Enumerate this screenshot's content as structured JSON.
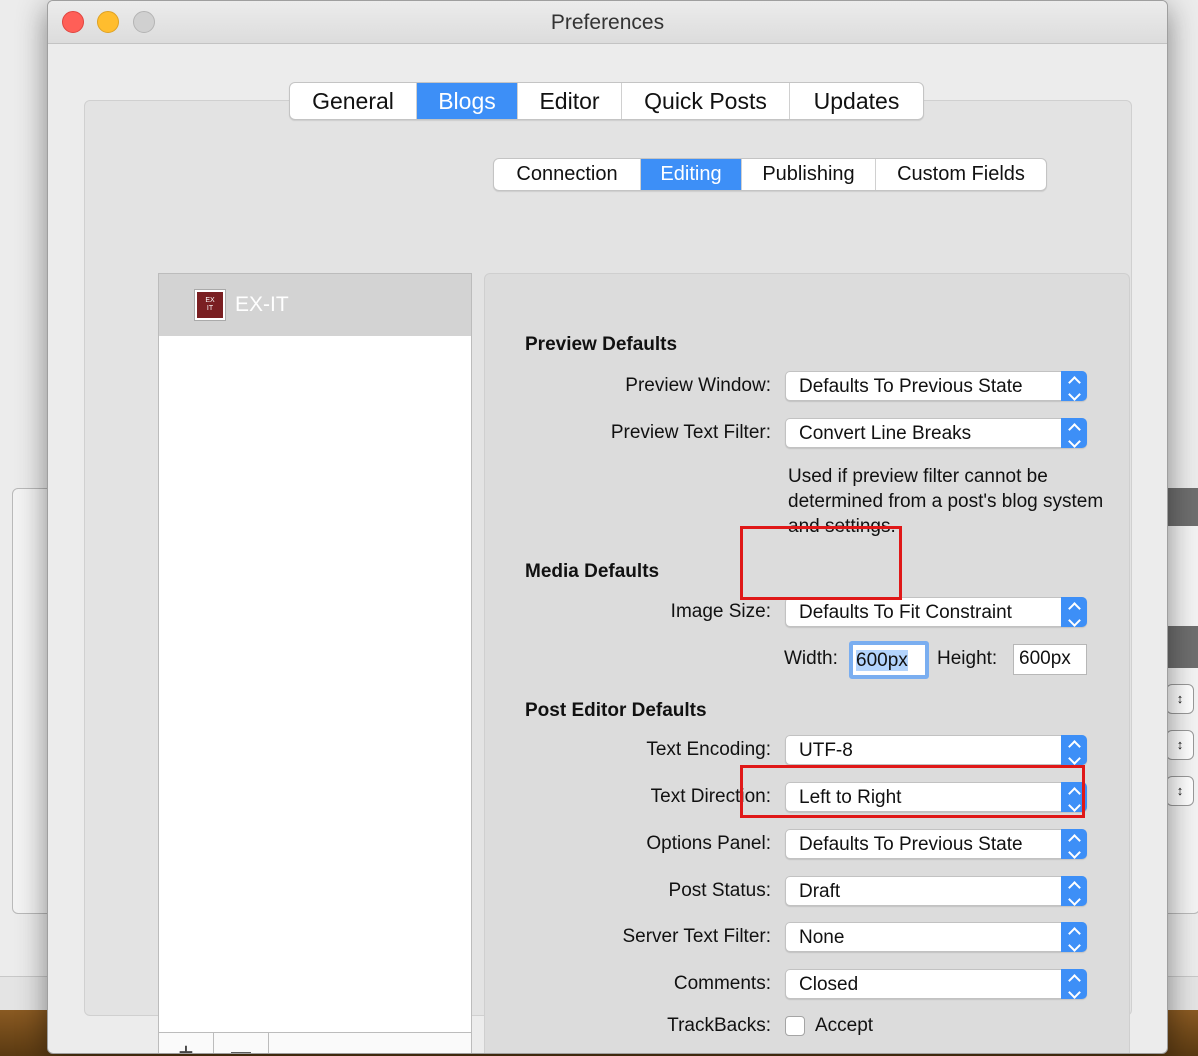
{
  "window": {
    "title": "Preferences"
  },
  "top_tabs": [
    "General",
    "Blogs",
    "Editor",
    "Quick Posts",
    "Updates"
  ],
  "top_tabs_active": "Blogs",
  "sub_tabs": [
    "Connection",
    "Editing",
    "Publishing",
    "Custom Fields"
  ],
  "sub_tabs_active": "Editing",
  "blog_list": {
    "items": [
      {
        "name": "EX-IT",
        "icon_text": "EX IT",
        "selected": true
      }
    ],
    "add_label": "+",
    "remove_label": "—"
  },
  "preview": {
    "heading": "Preview Defaults",
    "window_label": "Preview Window:",
    "window_value": "Defaults To Previous State",
    "filter_label": "Preview Text Filter:",
    "filter_value": "Convert Line Breaks",
    "note": "Used if preview filter cannot be determined from a post's blog system and settings."
  },
  "media": {
    "heading": "Media Defaults",
    "image_size_label": "Image Size:",
    "image_size_value": "Defaults To Fit Constraint",
    "width_label": "Width:",
    "width_value": "600px",
    "height_label": "Height:",
    "height_value": "600px"
  },
  "post_editor": {
    "heading": "Post Editor Defaults",
    "encoding_label": "Text Encoding:",
    "encoding_value": "UTF-8",
    "direction_label": "Text Direction:",
    "direction_value": "Left to Right",
    "options_label": "Options Panel:",
    "options_value": "Defaults To Previous State",
    "status_label": "Post Status:",
    "status_value": "Draft",
    "server_filter_label": "Server Text Filter:",
    "server_filter_value": "None",
    "comments_label": "Comments:",
    "comments_value": "Closed",
    "trackbacks_label": "TrackBacks:",
    "trackbacks_checkbox_label": "Accept",
    "trackbacks_checked": false
  },
  "colors": {
    "accent": "#3d8ff7",
    "highlight": "#e01818"
  }
}
